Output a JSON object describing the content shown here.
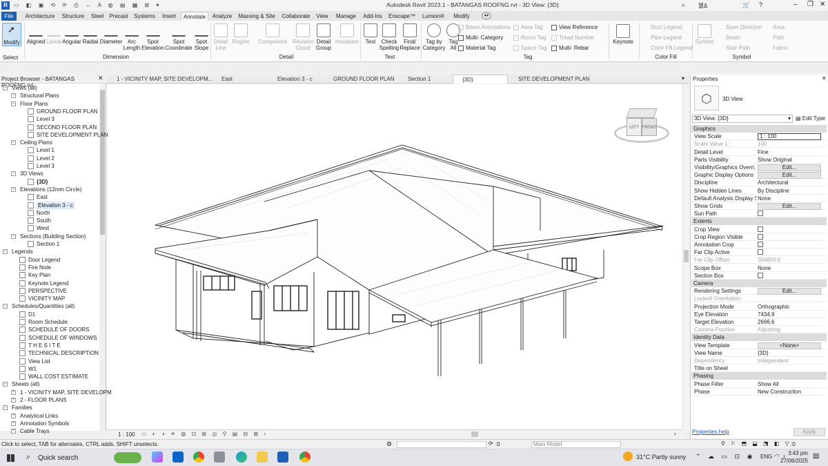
{
  "window": {
    "title": "Autodesk Revit 2023.1 - BATANGAS ROOFNG.rvt - 3D View: {3D}",
    "user": "慧Δ"
  },
  "menu_tabs": [
    "File",
    "Architecture",
    "Structure",
    "Steel",
    "Precast",
    "Systems",
    "Insert",
    "Annotate",
    "Analyze",
    "Massing & Site",
    "Collaborate",
    "View",
    "Manage",
    "Add-Ins",
    "Enscape™",
    "Lumion®",
    "Modify"
  ],
  "ribbon": {
    "modify": "Modify",
    "select": "Select",
    "dimension_buttons": [
      "Aligned",
      "Linear",
      "Angular",
      "Radial",
      "Diameter",
      "Arc Length",
      "Spot Elevation",
      "Spot Coordinate",
      "Spot Slope"
    ],
    "dimension_panel": "Dimension",
    "detail_buttons": [
      "Detail Line",
      "Region",
      "Component",
      "Revision Cloud",
      "Detail Group",
      "Insulation"
    ],
    "detail_panel": "Detail",
    "text_buttons": [
      "Text",
      "Check Spelling",
      "Find/ Replace"
    ],
    "text_panel": "Text",
    "tag_buttons": [
      "Tag by Category",
      "Tag All"
    ],
    "tag_small": [
      "Beam Annotations",
      "Multi- Category",
      "Material Tag",
      "Area Tag",
      "Room Tag",
      "Space Tag",
      "View Reference",
      "Tread Number",
      "Multi- Rebar"
    ],
    "tag_panel": "Tag",
    "keynote": "Keynote",
    "color_fill_items": [
      "Duct Legend",
      "Pipe Legend",
      "Color Fill Legend"
    ],
    "color_fill_panel": "Color Fill",
    "symbol": "Symbol",
    "symbol_items": [
      "Span Direction",
      "Beam",
      "Stair Path",
      "Area",
      "Path",
      "Fabric"
    ],
    "symbol_panel": "Symbol"
  },
  "view_tabs": [
    "1 - VICINITY MAP, SITE DEVELOPM...",
    "East",
    "Elevation 3 - c",
    "GROUND FLOOR PLAN",
    "Section 1",
    "{3D}",
    "SITE DEVELOPMENT PLAN"
  ],
  "project_browser": {
    "title": "Project Browser - BATANGAS ROOFNG.rvt",
    "items": [
      {
        "label": "Views (all)",
        "lvl": 0,
        "kind": "tree"
      },
      {
        "label": "Structural Plans",
        "lvl": 1,
        "kind": "tree"
      },
      {
        "label": "Floor Plans",
        "lvl": 1,
        "kind": "tree"
      },
      {
        "label": "GROUND FLOOR PLAN",
        "lvl": 2,
        "kind": "view"
      },
      {
        "label": "Level 3",
        "lvl": 2,
        "kind": "view"
      },
      {
        "label": "SECOND FLOOR PLAN",
        "lvl": 2,
        "kind": "view"
      },
      {
        "label": "SITE DEVELOPMENT PLAN",
        "lvl": 2,
        "kind": "view"
      },
      {
        "label": "Ceiling Plans",
        "lvl": 1,
        "kind": "tree"
      },
      {
        "label": "Level 1",
        "lvl": 2,
        "kind": "view"
      },
      {
        "label": "Level 2",
        "lvl": 2,
        "kind": "view"
      },
      {
        "label": "Level 3",
        "lvl": 2,
        "kind": "view"
      },
      {
        "label": "3D Views",
        "lvl": 1,
        "kind": "tree"
      },
      {
        "label": "{3D}",
        "lvl": 2,
        "kind": "view",
        "bold": true
      },
      {
        "label": "Elevations (12mm Circle)",
        "lvl": 1,
        "kind": "tree"
      },
      {
        "label": "East",
        "lvl": 2,
        "kind": "view"
      },
      {
        "label": "Elevation 3 - c",
        "lvl": 2,
        "kind": "view",
        "selected": true
      },
      {
        "label": "North",
        "lvl": 2,
        "kind": "view"
      },
      {
        "label": "South",
        "lvl": 2,
        "kind": "view"
      },
      {
        "label": "West",
        "lvl": 2,
        "kind": "view"
      },
      {
        "label": "Sections (Building Section)",
        "lvl": 1,
        "kind": "tree"
      },
      {
        "label": "Section 1",
        "lvl": 2,
        "kind": "view"
      },
      {
        "label": "Legends",
        "lvl": 0,
        "kind": "tree"
      },
      {
        "label": "Door Legend",
        "lvl": 1,
        "kind": "view"
      },
      {
        "label": "Fire Note",
        "lvl": 1,
        "kind": "view"
      },
      {
        "label": "Key Plan",
        "lvl": 1,
        "kind": "view"
      },
      {
        "label": "Keynote Legend",
        "lvl": 1,
        "kind": "view"
      },
      {
        "label": "PERSPECTIVE",
        "lvl": 1,
        "kind": "view"
      },
      {
        "label": "VICINITY MAP",
        "lvl": 1,
        "kind": "view"
      },
      {
        "label": "Schedules/Quantities (all)",
        "lvl": 0,
        "kind": "tree"
      },
      {
        "label": "D1",
        "lvl": 1,
        "kind": "view"
      },
      {
        "label": "Room Schedule",
        "lvl": 1,
        "kind": "view"
      },
      {
        "label": "SCHEDULE OF DOORS",
        "lvl": 1,
        "kind": "view"
      },
      {
        "label": "SCHEDULE OF WINDOWS",
        "lvl": 1,
        "kind": "view"
      },
      {
        "label": "T H E  S I T E",
        "lvl": 1,
        "kind": "view"
      },
      {
        "label": "TECHNICAL DESCRIPTION",
        "lvl": 1,
        "kind": "view"
      },
      {
        "label": "View List",
        "lvl": 1,
        "kind": "view"
      },
      {
        "label": "W1",
        "lvl": 1,
        "kind": "view"
      },
      {
        "label": "WALL COST ESTIMATE",
        "lvl": 1,
        "kind": "view"
      },
      {
        "label": "Sheets (all)",
        "lvl": 0,
        "kind": "tree"
      },
      {
        "label": "1 - VICINITY MAP, SITE DEVELOPM",
        "lvl": 1,
        "kind": "plus"
      },
      {
        "label": "2 - FLOOR PLANS",
        "lvl": 1,
        "kind": "plus"
      },
      {
        "label": "Families",
        "lvl": 0,
        "kind": "tree"
      },
      {
        "label": "Analytical Links",
        "lvl": 1,
        "kind": "plus"
      },
      {
        "label": "Annotation Symbols",
        "lvl": 1,
        "kind": "plus"
      },
      {
        "label": "Cable Trays",
        "lvl": 1,
        "kind": "plus"
      }
    ]
  },
  "view_control": {
    "scale": "1 : 100"
  },
  "properties": {
    "title": "Properties",
    "type_name": "3D View",
    "selector": "3D View: {3D}",
    "edit_type": "Edit Type",
    "groups": [
      {
        "name": "Graphics",
        "rows": [
          [
            "View Scale",
            "1 : 100",
            "input"
          ],
          [
            "Scale Value    1:",
            "100",
            "dis"
          ],
          [
            "Detail Level",
            "Fine",
            ""
          ],
          [
            "Parts Visibility",
            "Show Original",
            ""
          ],
          [
            "Visibility/Graphics Overri...",
            "Edit...",
            "btn"
          ],
          [
            "Graphic Display Options",
            "Edit...",
            "btn"
          ],
          [
            "Discipline",
            "Architectural",
            ""
          ],
          [
            "Show Hidden Lines",
            "By Discipline",
            ""
          ],
          [
            "Default Analysis Display S...",
            "None",
            ""
          ],
          [
            "Show Grids",
            "Edit...",
            "btn"
          ],
          [
            "Sun Path",
            "",
            "chk"
          ]
        ]
      },
      {
        "name": "Extents",
        "rows": [
          [
            "Crop View",
            "",
            "chk"
          ],
          [
            "Crop Region Visible",
            "",
            "chk"
          ],
          [
            "Annotation Crop",
            "",
            "chk"
          ],
          [
            "Far Clip Active",
            "",
            "chk"
          ],
          [
            "Far Clip Offset",
            "304800.0",
            "dis"
          ],
          [
            "Scope Box",
            "None",
            ""
          ],
          [
            "Section Box",
            "",
            "chk"
          ]
        ]
      },
      {
        "name": "Camera",
        "rows": [
          [
            "Rendering Settings",
            "Edit...",
            "btn"
          ],
          [
            "Locked Orientation",
            "",
            "dis"
          ],
          [
            "Projection Mode",
            "Orthographic",
            ""
          ],
          [
            "Eye Elevation",
            "7434.9",
            ""
          ],
          [
            "Target Elevation",
            "2696.6",
            ""
          ],
          [
            "Camera Position",
            "Adjusting",
            "dis"
          ]
        ]
      },
      {
        "name": "Identity Data",
        "rows": [
          [
            "View Template",
            "<None>",
            "btn"
          ],
          [
            "View Name",
            "{3D}",
            ""
          ],
          [
            "Dependency",
            "Independent",
            "dis"
          ],
          [
            "Title on Sheet",
            "",
            ""
          ]
        ]
      },
      {
        "name": "Phasing",
        "rows": [
          [
            "Phase Filter",
            "Show All",
            ""
          ],
          [
            "Phase",
            "New Construction",
            ""
          ]
        ]
      }
    ],
    "help": "Properties help",
    "apply": "Apply"
  },
  "status": {
    "hint": "Click to select, TAB for alternates, CTRL adds, SHIFT unselects.",
    "count": ":0",
    "model": "Main Model",
    "filter": ":0"
  },
  "viewcube": {
    "left": "LEFT",
    "front": "FRONT"
  },
  "taskbar": {
    "search": "Quick search",
    "weather": "31°C  Partly sunny",
    "lang": "ENG",
    "time": "3:43 pm",
    "date": "27/06/2025"
  }
}
